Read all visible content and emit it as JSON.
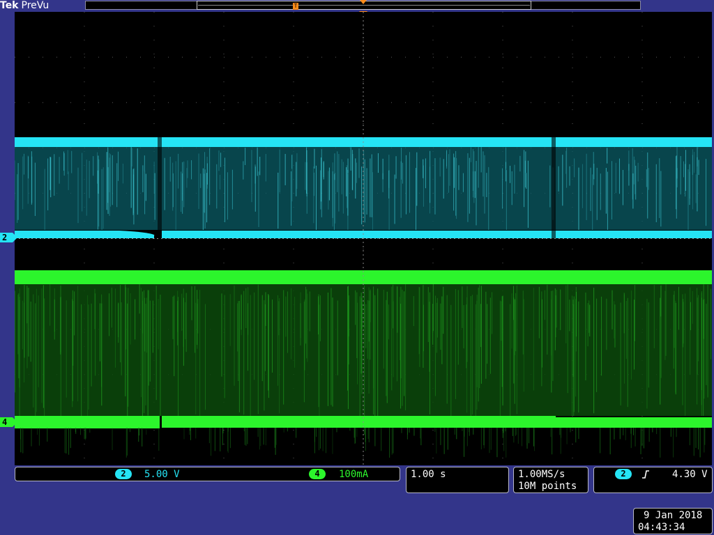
{
  "header": {
    "brand": "Tek",
    "mode": "PreVu"
  },
  "channels": {
    "ch2": {
      "label": "2",
      "scale": "5.00 V",
      "color": "#25e4f5"
    },
    "ch4": {
      "label": "4",
      "scale": "100mA",
      "color": "#2cf52c"
    }
  },
  "timebase": {
    "scale": "1.00 s"
  },
  "acquisition": {
    "rate": "1.00MS/s",
    "points": "10M points"
  },
  "trigger": {
    "source": "2",
    "slope_icon": "rising-edge-icon",
    "level": "4.30 V"
  },
  "datetime": {
    "date": "9 Jan  2018",
    "time": "04:43:34"
  },
  "record_marker": "T"
}
